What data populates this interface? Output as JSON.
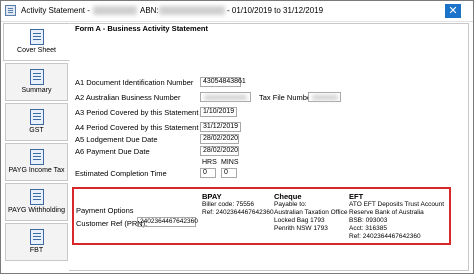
{
  "window": {
    "title_prefix": "Activity Statement - ",
    "abn_label": "ABN:",
    "period": "- 01/10/2019 to 31/12/2019",
    "close_glyph": "✕"
  },
  "tabs": [
    {
      "label": "Cover Sheet",
      "active": true
    },
    {
      "label": "Summary",
      "active": false
    },
    {
      "label": "GST",
      "active": false
    },
    {
      "label": "PAYG Income Tax",
      "active": false
    },
    {
      "label": "PAYG Withholding",
      "active": false
    },
    {
      "label": "FBT",
      "active": false
    }
  ],
  "form": {
    "title": "Form A - Business Activity Statement",
    "a1_label": "A1 Document Identification Number",
    "a1_value": "43054843861",
    "a2_label": "A2 Australian Business Number",
    "tfn_label": "Tax File Number",
    "a3_label": "A3 Period Covered by this Statement From",
    "a3_value": "1/10/2019",
    "a4_label": "A4 Period Covered by this Statement To",
    "a4_value": "31/12/2019",
    "a5_label": "A5 Lodgement Due Date",
    "a5_value": "28/02/2020",
    "a6_label": "A6 Payment Due Date",
    "a6_value": "28/02/2020",
    "hrs_label": "HRS",
    "mins_label": "MINS",
    "completion_label": "Estimated Completion Time",
    "completion_value": "0"
  },
  "payment": {
    "options_label": "Payment Options",
    "customer_ref_label": "Customer Ref (PRN):",
    "customer_ref_value": "2402364467642360",
    "bpay": {
      "heading": "BPAY",
      "biller": "Biller code: 75556",
      "ref": "Ref: 2402364467642360"
    },
    "cheque": {
      "heading": "Cheque",
      "line1": "Payable to:",
      "line2": "Australian Taxation Office",
      "line3": "Locked Bag 1793",
      "line4": "Penrith NSW 1793"
    },
    "eft": {
      "heading": "EFT",
      "line1": "ATO EFT Deposits Trust Account",
      "line2": "Reserve Bank of Australia",
      "line3": "BSB: 093003",
      "line4": "Acct: 316385",
      "line5": "Ref: 2402364467642360"
    }
  },
  "colors": {
    "highlight_border": "#d8282a",
    "close_button": "#1a73c9"
  }
}
